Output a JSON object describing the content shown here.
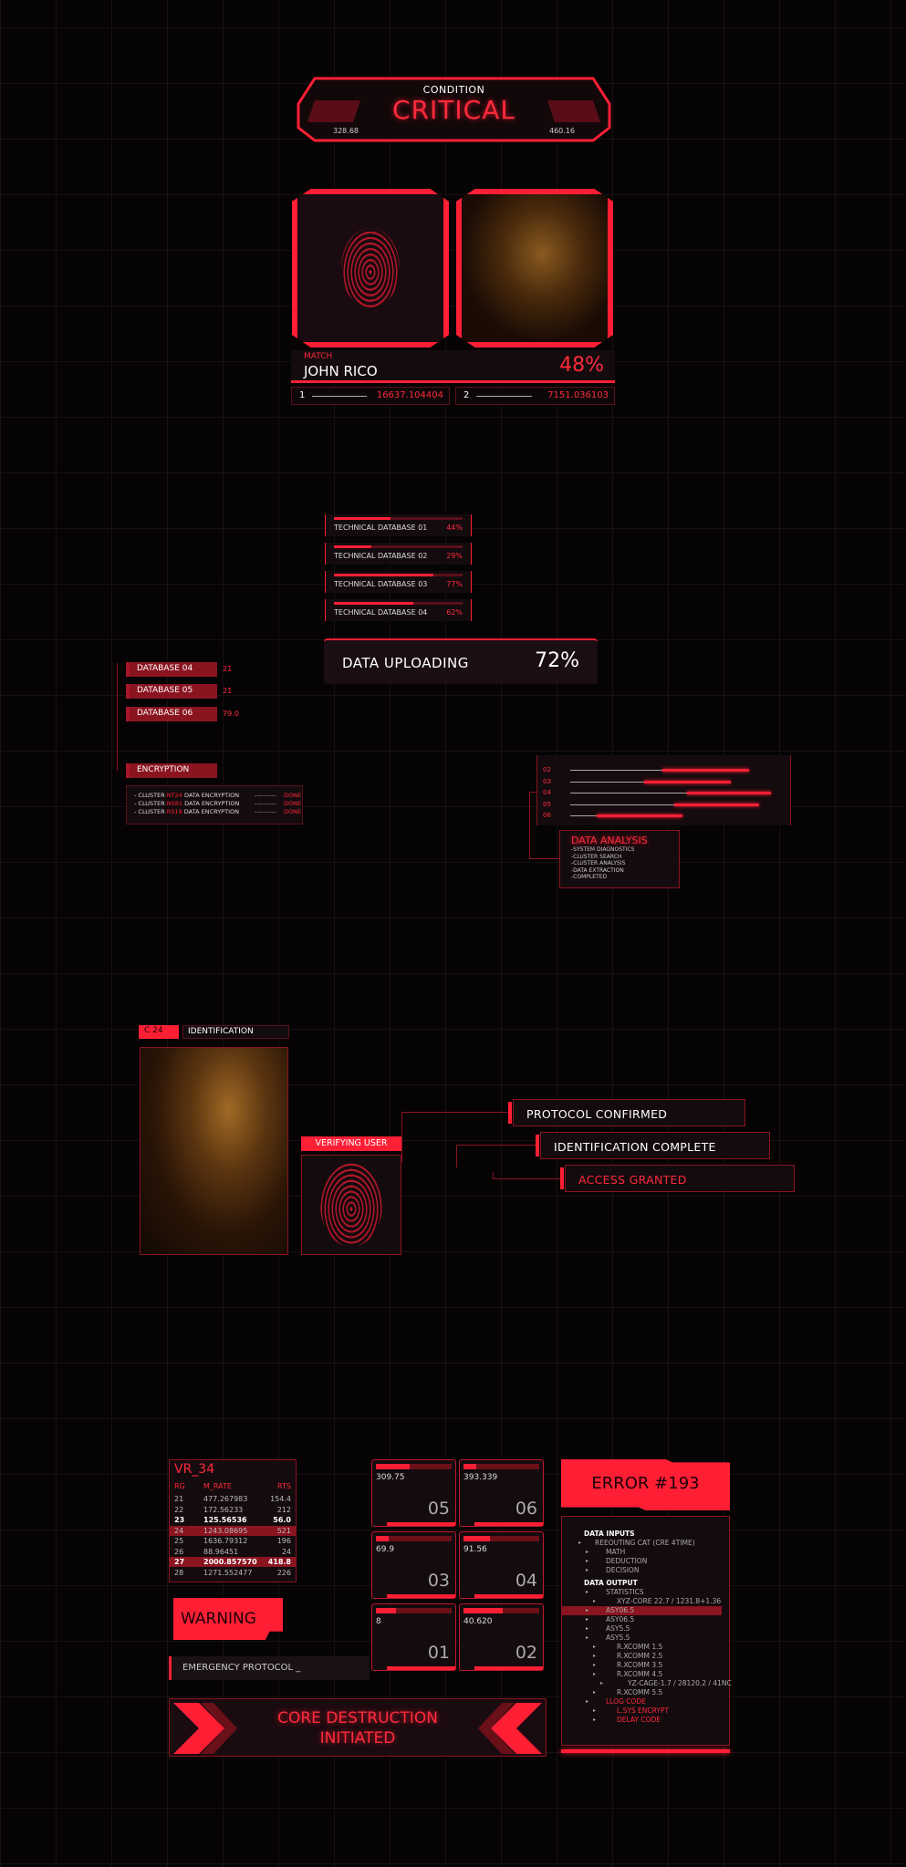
{
  "condition": {
    "label": "CONDITION",
    "status": "CRITICAL",
    "left_value": "328.68",
    "right_value": "460.16"
  },
  "match": {
    "label": "MATCH",
    "name": "JOHN RICO",
    "percent": "48%",
    "ids": [
      {
        "key": "1",
        "value": "16637.104404"
      },
      {
        "key": "2",
        "value": "7151.036103"
      }
    ]
  },
  "tech_databases": [
    {
      "name": "TECHNICAL DATABASE  01",
      "percent_label": "44%",
      "progress": 0.44
    },
    {
      "name": "TECHNICAL DATABASE  02",
      "percent_label": "29%",
      "progress": 0.29
    },
    {
      "name": "TECHNICAL DATABASE  03",
      "percent_label": "77%",
      "progress": 0.77
    },
    {
      "name": "TECHNICAL DATABASE  04",
      "percent_label": "62%",
      "progress": 0.62
    }
  ],
  "upload": {
    "label": "DATA UPLOADING",
    "percent": "72%"
  },
  "databases": [
    {
      "name": "DATABASE 04",
      "value": "21"
    },
    {
      "name": "DATABASE 05",
      "value": "21"
    },
    {
      "name": "DATABASE 06",
      "value": "79.0"
    }
  ],
  "encryption": {
    "label": "ENCRYPTION",
    "rows": [
      {
        "prefix": "- CLUSTER ",
        "cluster": "NT24",
        "suffix": " DATA ENCRYPTION",
        "dash": "----------",
        "status": "DONE"
      },
      {
        "prefix": "- CLUSTER ",
        "cluster": "NS81",
        "suffix": " DATA ENCRYPTION",
        "dash": "----------",
        "status": "DONE"
      },
      {
        "prefix": "- CLUSTER ",
        "cluster": "RS19",
        "suffix": " DATA ENCRYPTION",
        "dash": "----------",
        "status": "DONE"
      }
    ]
  },
  "data_analysis": {
    "bars": [
      {
        "label": "02",
        "start": 0.46,
        "end": 0.89
      },
      {
        "label": "03",
        "start": 0.37,
        "end": 0.8
      },
      {
        "label": "04",
        "start": 0.58,
        "end": 1.0
      },
      {
        "label": "05",
        "start": 0.52,
        "end": 0.94
      },
      {
        "label": "06",
        "start": 0.13,
        "end": 0.56
      }
    ],
    "title": "DATA ANALYSIS",
    "items": [
      "-SYSTEM DIAGNOSTICS",
      "-CLUSTER SEARCH",
      "-CLUSTER ANALYSIS",
      "-DATA EXTRACTION",
      "-COMPLETED"
    ]
  },
  "identification": {
    "code": "C  24",
    "label": "IDENTIFICATION",
    "verify_label": "VERIFYING USER",
    "statuses": [
      {
        "text": "PROTOCOL CONFIRMED",
        "color": "#ffffff"
      },
      {
        "text": "IDENTIFICATION COMPLETE",
        "color": "#ffffff"
      },
      {
        "text": "ACCESS GRANTED",
        "color": "#ff2a3c"
      }
    ]
  },
  "vr_table": {
    "title": "VR_34",
    "headers": [
      "RG",
      "M_RATE",
      "RTS"
    ],
    "rows": [
      {
        "rg": "21",
        "rate": "477.267983",
        "rts": "154.4",
        "style": ""
      },
      {
        "rg": "22",
        "rate": "172.56233",
        "rts": "212",
        "style": ""
      },
      {
        "rg": "23",
        "rate": "125.56536",
        "rts": "56.0",
        "style": "bold"
      },
      {
        "rg": "24",
        "rate": "1243.08695",
        "rts": "521",
        "style": "hl"
      },
      {
        "rg": "25",
        "rate": "1636.79312",
        "rts": "196",
        "style": ""
      },
      {
        "rg": "26",
        "rate": "88.96451",
        "rts": "24",
        "style": ""
      },
      {
        "rg": "27",
        "rate": "2000.857570",
        "rts": "418.8",
        "style": "hl bold"
      },
      {
        "rg": "28",
        "rate": "1271.552477",
        "rts": "226",
        "style": ""
      }
    ]
  },
  "tiles": [
    {
      "id": "05",
      "value": "309.75",
      "progress": 0.44
    },
    {
      "id": "06",
      "value": "393.339",
      "progress": 0.17
    },
    {
      "id": "03",
      "value": "69.9",
      "progress": 0.17
    },
    {
      "id": "04",
      "value": "91.56",
      "progress": 0.35
    },
    {
      "id": "01",
      "value": "8",
      "progress": 0.26
    },
    {
      "id": "02",
      "value": "40.620",
      "progress": 0.52
    }
  ],
  "warning": {
    "label": "WARNING",
    "emergency": "EMERGENCY PROTOCOL _",
    "core_line1": "CORE DESTRUCTION",
    "core_line2": "INITIATED"
  },
  "error": {
    "title": "ERROR #193",
    "lines": [
      {
        "text": "DATA INPUTS",
        "indent": 0,
        "type": "head"
      },
      {
        "text": "REEOUTING CAT (CRE 4TIME)",
        "indent": 1,
        "type": ""
      },
      {
        "text": "MATH",
        "indent": 2,
        "type": ""
      },
      {
        "text": "DEDUCTION",
        "indent": 2,
        "type": ""
      },
      {
        "text": "DECISION",
        "indent": 2,
        "type": ""
      },
      {
        "text": "DATA OUTPUT",
        "indent": 0,
        "type": "head"
      },
      {
        "text": "STATISTICS",
        "indent": 2,
        "type": ""
      },
      {
        "text": "XYZ-CORE 22.7 / 1231.8+1.36",
        "indent": 3,
        "type": ""
      },
      {
        "text": "ASY06.5",
        "indent": 2,
        "type": "hl"
      },
      {
        "text": "ASY06.5",
        "indent": 2,
        "type": ""
      },
      {
        "text": "ASY5.5",
        "indent": 2,
        "type": ""
      },
      {
        "text": "ASY5.5",
        "indent": 2,
        "type": ""
      },
      {
        "text": "R.XCOMM 1.5",
        "indent": 3,
        "type": ""
      },
      {
        "text": "R.XCOMM 2.5",
        "indent": 3,
        "type": ""
      },
      {
        "text": "R.XCOMM 3.5",
        "indent": 3,
        "type": ""
      },
      {
        "text": "R.XCOMM 4.5",
        "indent": 3,
        "type": ""
      },
      {
        "text": "YZ-CAGE-1.7 / 28120.2 / 41NC",
        "indent": 4,
        "type": ""
      },
      {
        "text": "R.XCOMM 5.5",
        "indent": 3,
        "type": ""
      },
      {
        "text": "LLOG CODE",
        "indent": 2,
        "type": "red"
      },
      {
        "text": "L.SYS ENCRYPT",
        "indent": 3,
        "type": "red"
      },
      {
        "text": "DELAY CODE",
        "indent": 3,
        "type": "red"
      }
    ]
  }
}
